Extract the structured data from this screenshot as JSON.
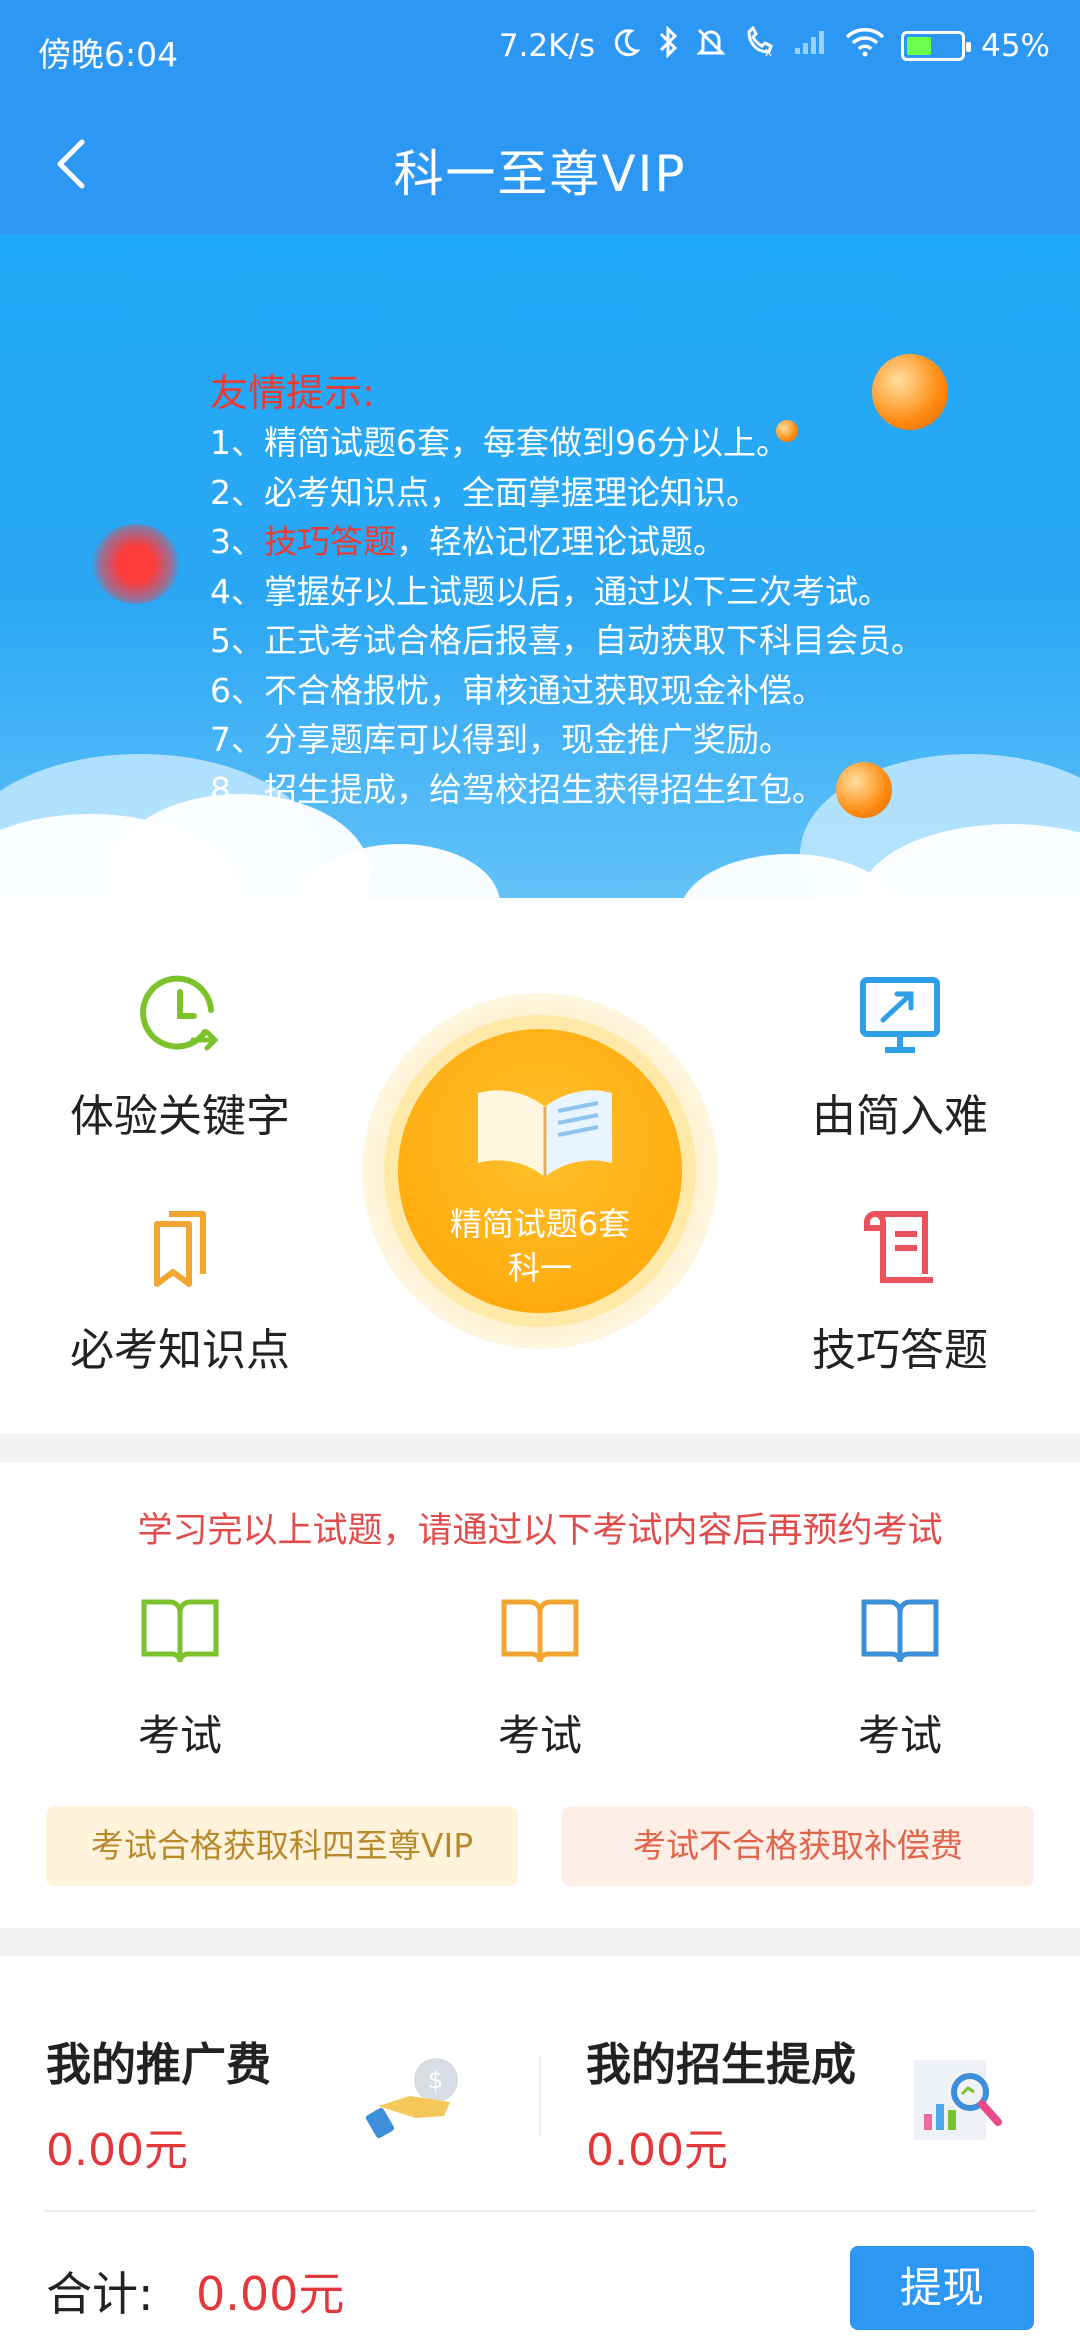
{
  "status_bar": {
    "time": "傍晚6:04",
    "net_speed": "7.2K/s",
    "battery": "45%",
    "battery_level": 0.45
  },
  "header": {
    "title": "科一至尊VIP",
    "back_icon": "chevron-left-icon"
  },
  "banner": {
    "heading": "友情提示:",
    "lines": [
      {
        "prefix": "1、精简试题6套，每套做到96分以上。",
        "red": "",
        "suffix": ""
      },
      {
        "prefix": "2、必考知识点，全面掌握理论知识。",
        "red": "",
        "suffix": ""
      },
      {
        "prefix": "3、",
        "red": "技巧答题",
        "suffix": "，轻松记忆理论试题。"
      },
      {
        "prefix": "4、掌握好以上试题以后，通过以下三次考试。",
        "red": "",
        "suffix": ""
      },
      {
        "prefix": "5、正式考试合格后报喜，自动获取下科目会员。",
        "red": "",
        "suffix": ""
      },
      {
        "prefix": "6、不合格报忧，审核通过获取现金补偿。",
        "red": "",
        "suffix": ""
      },
      {
        "prefix": "7、分享题库可以得到，现金推广奖励。",
        "red": "",
        "suffix": ""
      },
      {
        "prefix": "8、招生提成，给驾校招生获得招生红包。",
        "red": "",
        "suffix": ""
      }
    ]
  },
  "features": {
    "keyword": "体验关键字",
    "progressive": "由简入难",
    "must_know": "必考知识点",
    "tips": "技巧答题",
    "center_line1": "精简试题6套",
    "center_line2": "科一"
  },
  "exam": {
    "notice": "学习完以上试题，请通过以下考试内容后再预约考试",
    "items": [
      "考试",
      "考试",
      "考试"
    ],
    "pass_reward": "考试合格获取科四至尊VIP",
    "fail_reward": "考试不合格获取补偿费"
  },
  "earnings": {
    "promo_title": "我的推广费",
    "promo_value": "0.00元",
    "recruit_title": "我的招生提成",
    "recruit_value": "0.00元",
    "total_label": "合计:",
    "total_value": "0.00元",
    "withdraw": "提现"
  },
  "colors": {
    "primary": "#2d97f4",
    "accent_red": "#e3383b",
    "gold": "#ffad10"
  }
}
